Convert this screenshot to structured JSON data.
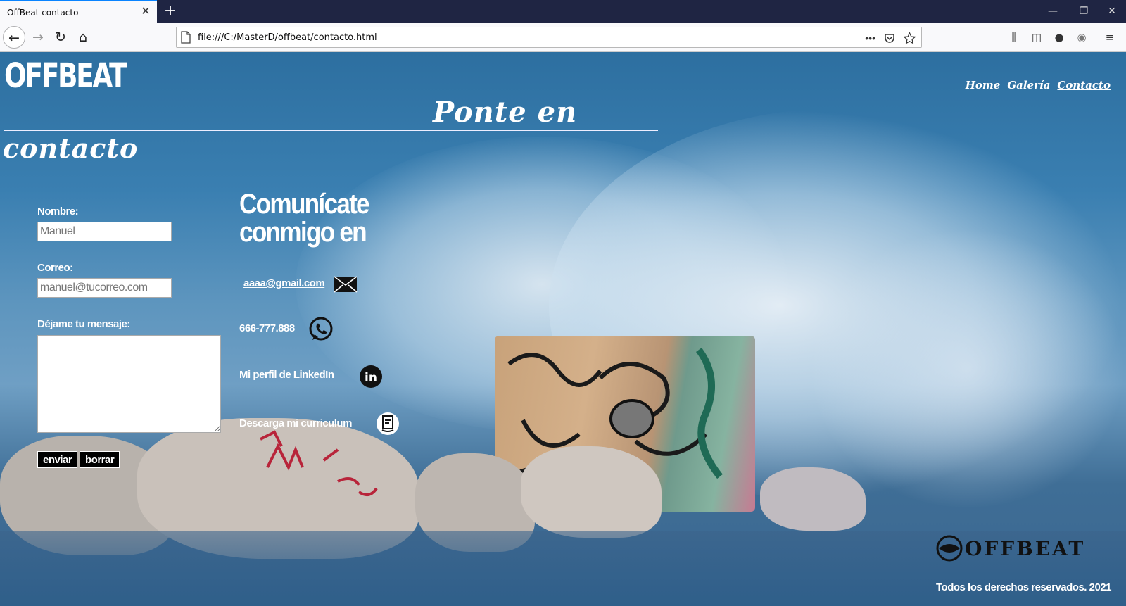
{
  "browser": {
    "tab_title": "OffBeat contacto",
    "tab_close": "✕",
    "new_tab": "+",
    "url": "file:///C:/MasterD/offbeat/contacto.html",
    "window_controls": [
      "—",
      "❐",
      "✕"
    ]
  },
  "site": {
    "logo": "OFFBEAT",
    "nav": [
      {
        "label": "Home"
      },
      {
        "label": "Galería"
      },
      {
        "label": "Contacto"
      }
    ],
    "heading_line1": "Ponte en",
    "heading_line2": "contacto"
  },
  "form": {
    "name_label": "Nombre:",
    "name_value": "Manuel",
    "email_label": "Correo:",
    "email_value": "manuel@tucorreo.com",
    "message_label": "Déjame tu mensaje:",
    "message_value": "",
    "submit_label": "enviar",
    "reset_label": "borrar"
  },
  "contact": {
    "title": "Comunícate conmigo en",
    "email": "aaaa@gmail.com",
    "phone": "666-777.888",
    "linkedin": "Mi perfil de LinkedIn",
    "cv": "Descarga mi curriculum"
  },
  "footer": {
    "logo": "OFFBEAT",
    "copyright": "Todos los derechos reservados. 2021"
  },
  "colors": {
    "browser_frame": "#1f2543",
    "toolbar": "#f9f9fb",
    "sea_blue": "#2d6fa0",
    "text": "#ffffff"
  }
}
